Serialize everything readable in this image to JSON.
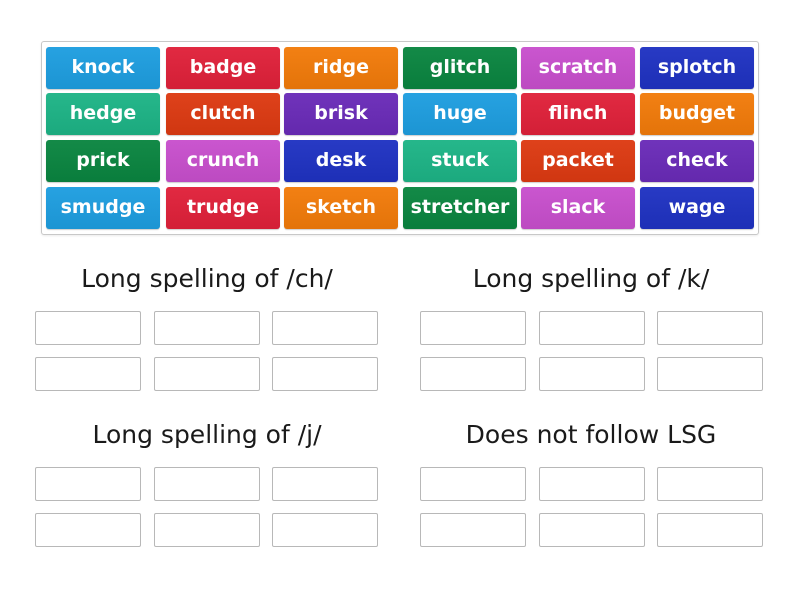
{
  "tiles": [
    {
      "label": "knock",
      "color": "#1e9ee0"
    },
    {
      "label": "badge",
      "color": "#e0213a"
    },
    {
      "label": "ridge",
      "color": "#f27b0a"
    },
    {
      "label": "glitch",
      "color": "#0a8540"
    },
    {
      "label": "scratch",
      "color": "#c84fcd"
    },
    {
      "label": "splotch",
      "color": "#1f32c2"
    },
    {
      "label": "hedge",
      "color": "#1db486"
    },
    {
      "label": "clutch",
      "color": "#dd3a12"
    },
    {
      "label": "brisk",
      "color": "#6a2bb8"
    },
    {
      "label": "huge",
      "color": "#1e9ee0"
    },
    {
      "label": "flinch",
      "color": "#e0213a"
    },
    {
      "label": "budget",
      "color": "#f27b0a"
    },
    {
      "label": "prick",
      "color": "#0a8540"
    },
    {
      "label": "crunch",
      "color": "#c84fcd"
    },
    {
      "label": "desk",
      "color": "#1f32c2"
    },
    {
      "label": "stuck",
      "color": "#1db486"
    },
    {
      "label": "packet",
      "color": "#dd3a12"
    },
    {
      "label": "check",
      "color": "#6a2bb8"
    },
    {
      "label": "smudge",
      "color": "#1e9ee0"
    },
    {
      "label": "trudge",
      "color": "#e0213a"
    },
    {
      "label": "sketch",
      "color": "#f27b0a"
    },
    {
      "label": "stretcher",
      "color": "#0a8540"
    },
    {
      "label": "slack",
      "color": "#c84fcd"
    },
    {
      "label": "wage",
      "color": "#1f32c2"
    }
  ],
  "groups": [
    {
      "title": "Long spelling of /ch/",
      "slots": 6
    },
    {
      "title": "Long spelling of /k/",
      "slots": 6
    },
    {
      "title": "Long spelling of /j/",
      "slots": 6
    },
    {
      "title": "Does not follow LSG",
      "slots": 6
    }
  ]
}
